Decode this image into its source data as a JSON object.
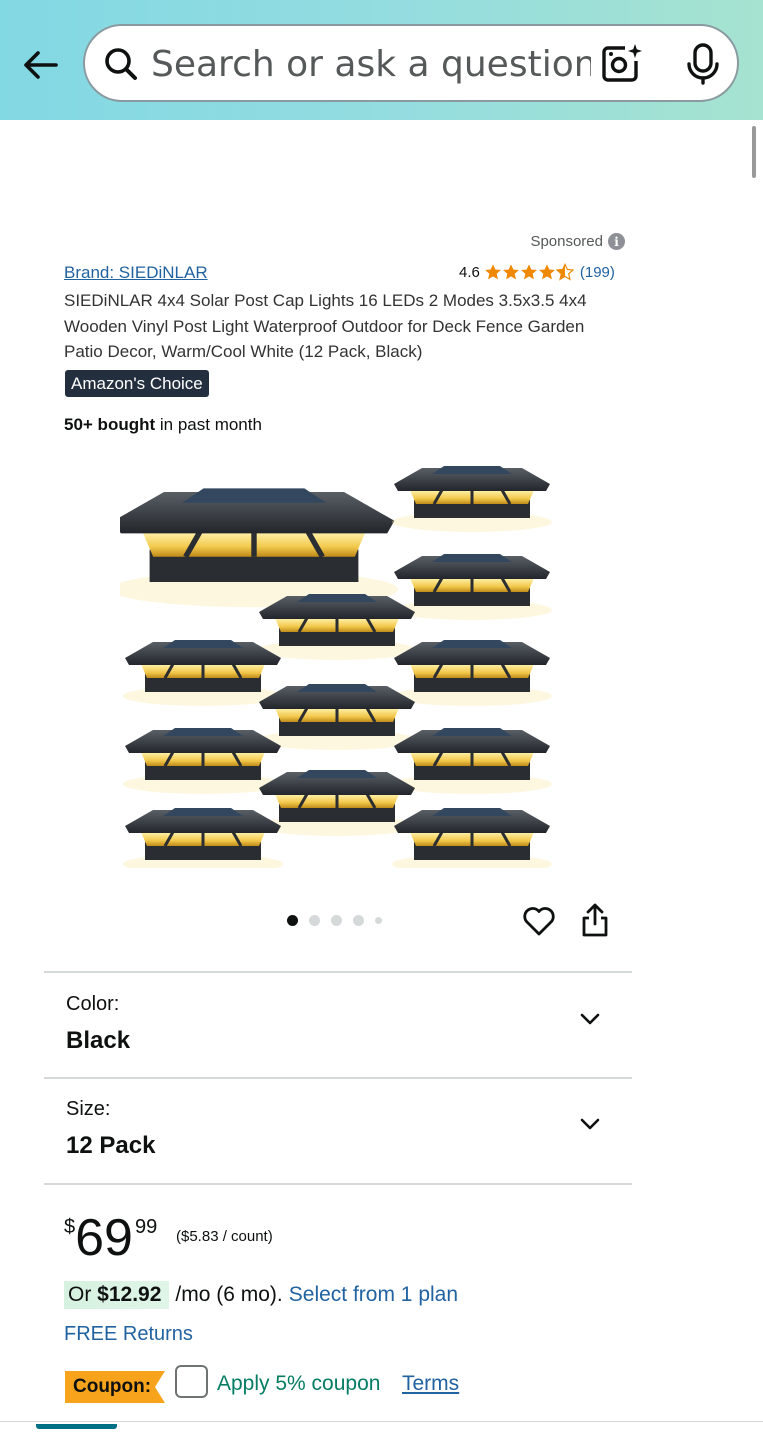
{
  "header": {
    "search_placeholder": "Search or ask a question"
  },
  "product": {
    "sponsored_label": "Sponsored",
    "brand": "Brand: SIEDiNLAR",
    "rating_value": "4.6",
    "rating_stars": 4.5,
    "rating_count": "(199)",
    "title": "SIEDiNLAR 4x4 Solar Post Cap Lights 16 LEDs 2 Modes 3.5x3.5 4x4 Wooden Vinyl Post Light Waterproof Outdoor for Deck Fence Garden Patio Decor, Warm/Cool White (12 Pack, Black)",
    "badge": "Amazon's Choice",
    "bought_bold": "50+ bought",
    "bought_rest": " in past month",
    "image_count": 5,
    "active_image": 1
  },
  "variations": {
    "color_label": "Color:",
    "color_value": "Black",
    "size_label": "Size:",
    "size_value": "12 Pack"
  },
  "pricing": {
    "currency": "$",
    "whole": "69",
    "fraction": "99",
    "unit_price": "($5.83 / count)",
    "monthly_prefix": "Or ",
    "monthly_amount": "$12.92",
    "monthly_suffix": " /mo (6 mo).",
    "plan_link": "Select from 1 plan",
    "free_returns": "FREE Returns"
  },
  "coupon": {
    "badge": "Coupon:",
    "text": "Apply 5% coupon",
    "terms": "Terms"
  },
  "colors": {
    "link": "#2162a1",
    "badge_bg": "#232f3e",
    "coupon_orange": "#f7a41c",
    "coupon_green": "#067d62",
    "star": "#f08804"
  }
}
